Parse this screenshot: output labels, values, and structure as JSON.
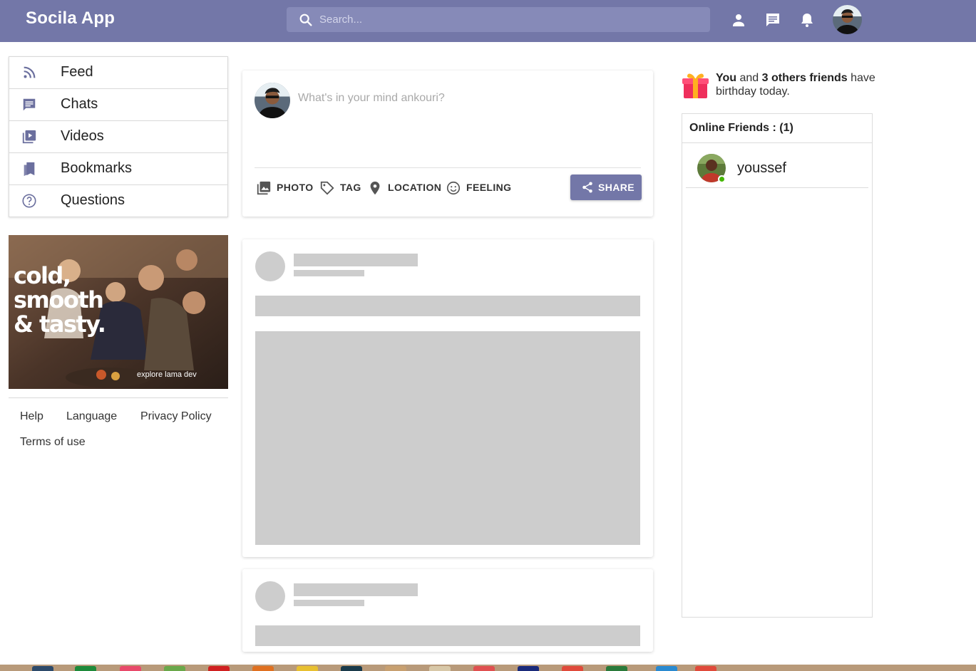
{
  "app": {
    "name": "Socila App"
  },
  "search": {
    "placeholder": "Search..."
  },
  "header_icons": [
    "person-icon",
    "chat-icon",
    "notifications-icon"
  ],
  "sidebar": {
    "items": [
      {
        "label": "Feed",
        "icon": "rss-feed-icon"
      },
      {
        "label": "Chats",
        "icon": "chat-icon"
      },
      {
        "label": "Videos",
        "icon": "video-library-icon"
      },
      {
        "label": "Bookmarks",
        "icon": "bookmarks-icon"
      },
      {
        "label": "Questions",
        "icon": "help-outline-icon"
      }
    ],
    "ad": {
      "headline_line1": "cold,",
      "headline_line2": "smooth",
      "headline_line3": "& tasty.",
      "caption": "explore lama dev"
    },
    "footer_links": [
      "Help",
      "Language",
      "Privacy Policy",
      "Terms of use"
    ]
  },
  "share": {
    "placeholder": "What's in your mind ankouri?",
    "options": [
      {
        "label": "PHOTO",
        "icon": "photo-library-icon"
      },
      {
        "label": "TAG",
        "icon": "label-icon"
      },
      {
        "label": "LOCATION",
        "icon": "location-pin-icon"
      },
      {
        "label": "FEELING",
        "icon": "emoji-smile-icon"
      }
    ],
    "button_label": "SHARE"
  },
  "birthday": {
    "you": "You",
    "and": "and",
    "count_text": "3 others friends",
    "rest": "have birthday today."
  },
  "online": {
    "title": "Online Friends : (1)",
    "friends": [
      {
        "name": "youssef",
        "online": true
      }
    ]
  },
  "colors": {
    "primary": "#7377a8",
    "skeleton": "#cdcdcd",
    "online_dot": "#44b700"
  }
}
